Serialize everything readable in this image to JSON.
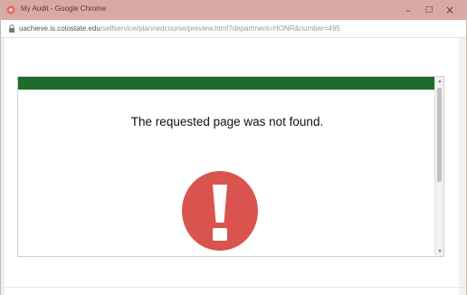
{
  "window": {
    "title": "My Audit - Google Chrome",
    "controls": {
      "minimize": "–",
      "maximize": "□",
      "close": "×"
    }
  },
  "address_bar": {
    "url_host": "uachieve.is.colostate.edu",
    "url_path": "/selfservice/plannedcourse/preview.html?department=HONR&number=495",
    "icon": "lock-icon"
  },
  "page": {
    "message": "The requested page was not found.",
    "icon": "error-exclamation-icon"
  },
  "scrollbar": {
    "up_arrow": "▲",
    "down_arrow": "▼"
  },
  "colors": {
    "titlebar": "#d9a9a3",
    "header_band": "#1e6b2c",
    "error_icon": "#d9534f"
  }
}
